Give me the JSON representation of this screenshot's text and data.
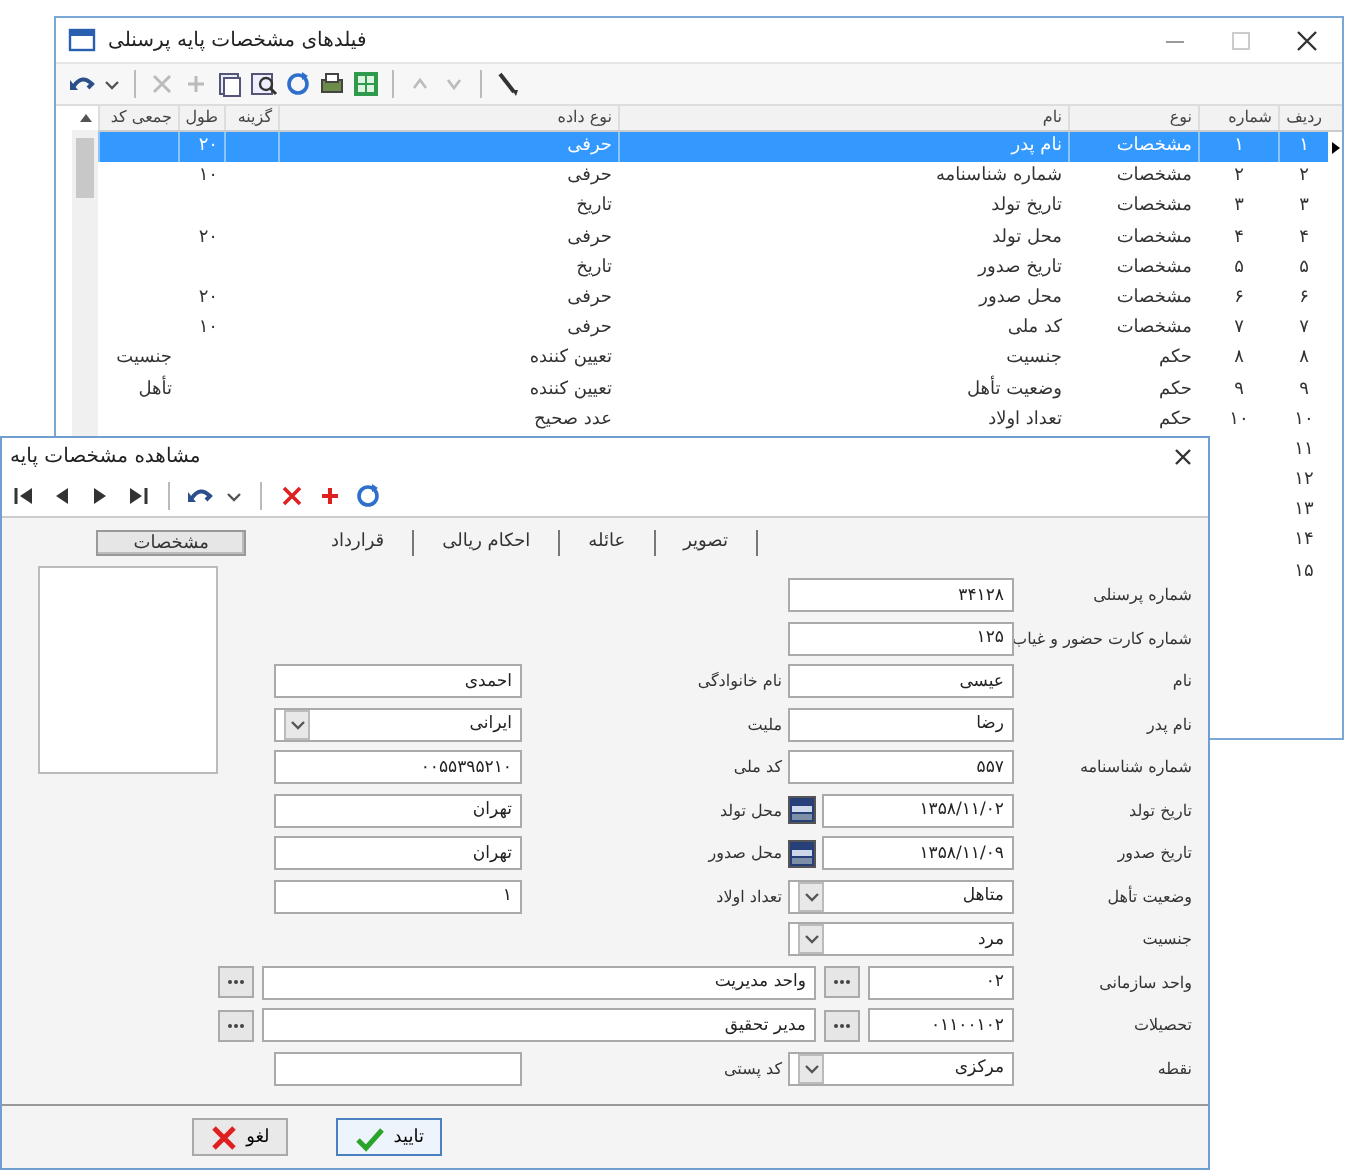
{
  "main_window": {
    "title": "فیلدهای مشخصات پایه پرسنلی",
    "table": {
      "columns": [
        "ردیف",
        "شماره",
        "نوع",
        "نام",
        "نوع داده",
        "گزینه",
        "طول",
        "جمعی کد"
      ],
      "rows": [
        {
          "row_no": "۱",
          "number": "۱",
          "type": "مشخصات",
          "name": "نام پدر",
          "data_type": "حرفی",
          "length": "۲۰",
          "selected": true
        },
        {
          "row_no": "۲",
          "number": "۲",
          "type": "مشخصات",
          "name": "شماره شناسنامه",
          "data_type": "حرفی",
          "length": "۱۰",
          "selected": false
        },
        {
          "row_no": "۳",
          "number": "۳",
          "type": "مشخصات",
          "name": "تاریخ تولد",
          "data_type": "تاریخ",
          "selected": false
        },
        {
          "row_no": "۴",
          "number": "۴",
          "type": "مشخصات",
          "name": "محل تولد",
          "data_type": "حرفی",
          "length": "۲۰",
          "selected": false
        },
        {
          "row_no": "۵",
          "number": "۵",
          "type": "مشخصات",
          "name": "تاریخ صدور",
          "data_type": "تاریخ",
          "selected": false
        },
        {
          "row_no": "۶",
          "number": "۶",
          "type": "مشخصات",
          "name": "محل صدور",
          "data_type": "حرفی",
          "length": "۲۰",
          "selected": false
        },
        {
          "row_no": "۷",
          "number": "۷",
          "type": "مشخصات",
          "name": "کد ملی",
          "data_type": "حرفی",
          "length": "۱۰",
          "selected": false
        },
        {
          "row_no": "۸",
          "number": "۸",
          "type": "حکم",
          "name": "جنسیت",
          "data_type": "تعیین کننده",
          "group_code": "جنسیت",
          "selected": false
        },
        {
          "row_no": "۹",
          "number": "۹",
          "type": "حکم",
          "name": "وضعیت تأهل",
          "data_type": "تعیین کننده",
          "group_code": "تأهل",
          "selected": false
        },
        {
          "row_no": "۱۰",
          "number": "۱۰",
          "type": "حکم",
          "name": "تعداد اولاد",
          "data_type": "عدد صحیح",
          "selected": false
        },
        {
          "row_no": "۱۱",
          "selected": false
        },
        {
          "row_no": "۱۲",
          "selected": false
        },
        {
          "row_no": "۱۳",
          "selected": false
        },
        {
          "row_no": "۱۴",
          "selected": false
        },
        {
          "row_no": "۱۵",
          "selected": false
        }
      ]
    }
  },
  "dialog": {
    "title": "مشاهده مشخصات پایه",
    "tabs": [
      {
        "label": "تصویر",
        "selected": false
      },
      {
        "label": "عائله",
        "selected": false
      },
      {
        "label": "احکام ریالی",
        "selected": false
      },
      {
        "label": "قرارداد",
        "selected": false
      },
      {
        "label": "مشخصات",
        "selected": true
      }
    ],
    "form_rows": [
      {
        "right": {
          "label": "شماره پرسنلی",
          "kind": "text",
          "value": "۳۴۱۲۸"
        }
      },
      {
        "right": {
          "label": "شماره کارت حضور و غیاب",
          "kind": "text",
          "value": "۱۲۵"
        }
      },
      {
        "right": {
          "label": "نام",
          "kind": "text",
          "value": "عیسی"
        },
        "left": {
          "label": "نام خانوادگی",
          "kind": "text",
          "value": "احمدی"
        }
      },
      {
        "right": {
          "label": "نام پدر",
          "kind": "text",
          "value": "رضا"
        },
        "left": {
          "label": "ملیت",
          "kind": "combo",
          "value": "ایرانی"
        }
      },
      {
        "right": {
          "label": "شماره شناسنامه",
          "kind": "text",
          "value": "۵۵۷"
        },
        "left": {
          "label": "کد ملی",
          "kind": "text",
          "value": "۰۰۵۵۳۹۵۲۱۰"
        }
      },
      {
        "right": {
          "label": "تاریخ تولد",
          "kind": "date",
          "value": "۱۳۵۸/۱۱/۰۲"
        },
        "left": {
          "label": "محل تولد",
          "kind": "text",
          "value": "تهران"
        }
      },
      {
        "right": {
          "label": "تاریخ صدور",
          "kind": "date",
          "value": "۱۳۵۸/۱۱/۰۹"
        },
        "left": {
          "label": "محل صدور",
          "kind": "text",
          "value": "تهران"
        }
      },
      {
        "right": {
          "label": "وضعیت تأهل",
          "kind": "combo",
          "value": "متاهل"
        },
        "left": {
          "label": "تعداد اولاد",
          "kind": "text",
          "value": "۱"
        }
      },
      {
        "right": {
          "label": "جنسیت",
          "kind": "combo",
          "value": "مرد"
        }
      },
      {
        "right": {
          "label": "واحد سازمانی",
          "kind": "lookup",
          "code": "۰۲",
          "name": "واحد مدیریت"
        }
      },
      {
        "right": {
          "label": "تحصیلات",
          "kind": "lookup",
          "code": "۰۱۱۰۰۱۰۲",
          "name": "مدیر تحقیق"
        }
      },
      {
        "right": {
          "label": "نقطه",
          "kind": "combo",
          "value": "مرکزی"
        },
        "left": {
          "label": "کد پستی",
          "kind": "text"
        }
      }
    ],
    "buttons": [
      {
        "label": "تایید",
        "kind": "confirm"
      },
      {
        "label": "لغو",
        "kind": "cancel"
      }
    ]
  }
}
